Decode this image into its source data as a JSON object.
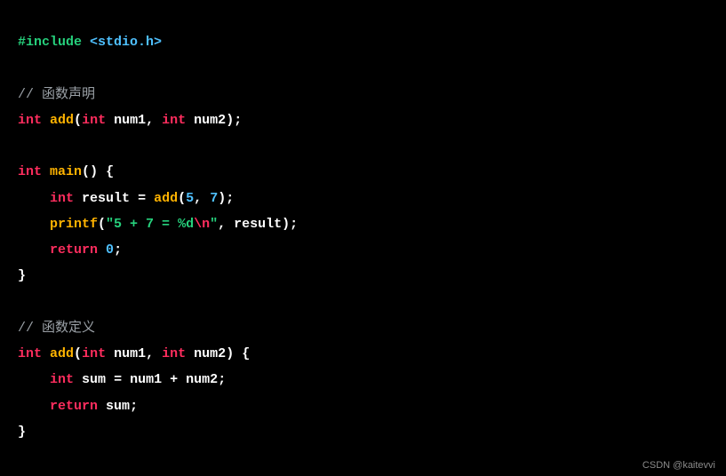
{
  "code": {
    "include_directive": "#include",
    "include_header": "<stdio.h>",
    "comment_decl": "// 函数声明",
    "kw_int": "int",
    "fn_add": "add",
    "fn_main": "main",
    "fn_printf": "printf",
    "param_num1": "num1",
    "param_num2": "num2",
    "ident_result": "result",
    "ident_sum": "sum",
    "num_5": "5",
    "num_7": "7",
    "num_0": "0",
    "str_part1": "\"5 + 7 = ",
    "str_fmt": "%d",
    "str_esc": "\\n",
    "str_part2": "\"",
    "kw_return": "return",
    "comment_def": "// 函数定义",
    "op_plus": "+",
    "op_eq": "=",
    "semicolon": ";",
    "comma": ",",
    "lparen": "(",
    "rparen": ")",
    "lbrace": "{",
    "rbrace": "}",
    "space": " ",
    "indent": "    "
  },
  "watermark": "CSDN @kaitevvi"
}
